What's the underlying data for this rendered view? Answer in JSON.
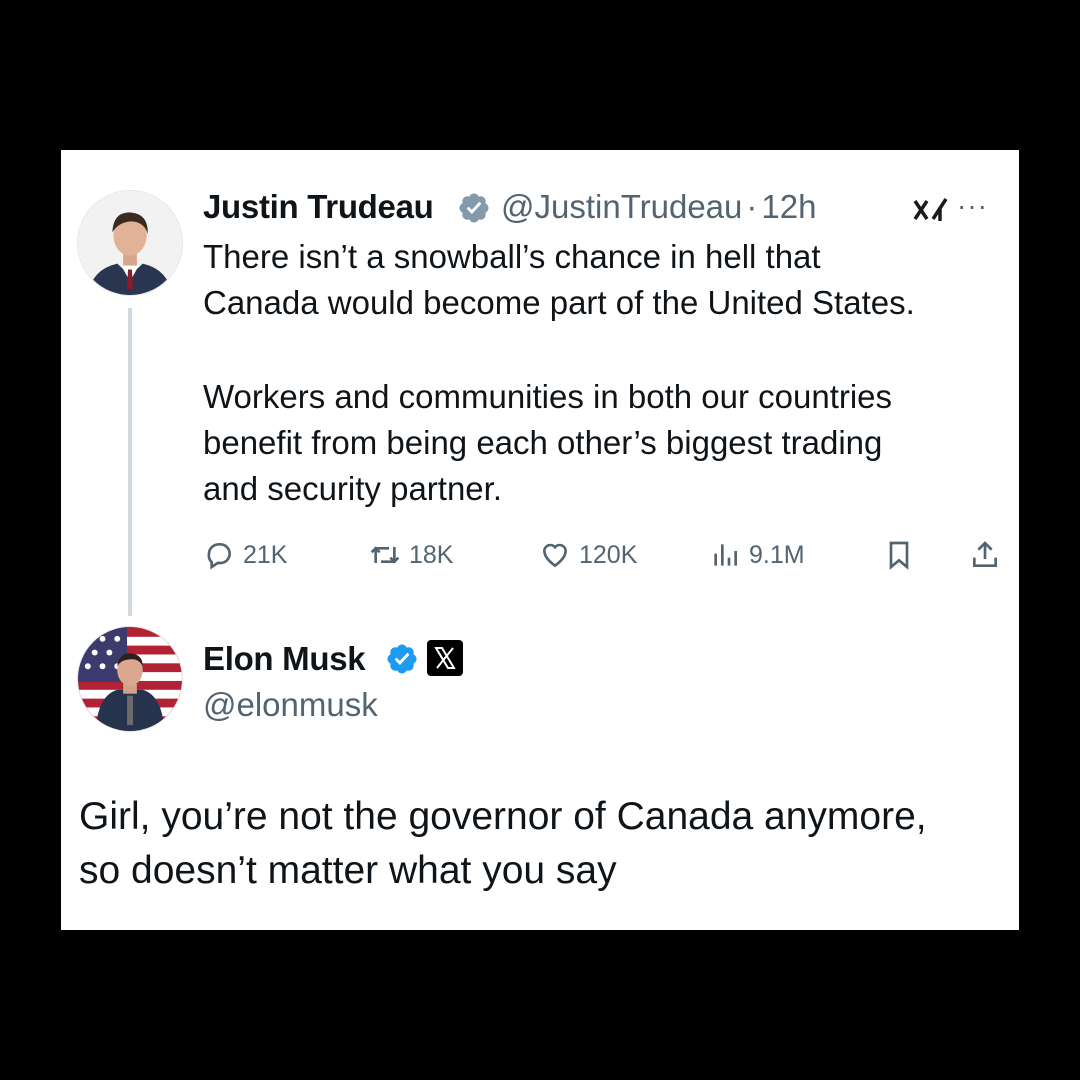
{
  "tweet1": {
    "author_name": "Justin Trudeau",
    "handle": "@JustinTrudeau",
    "separator": "·",
    "time": "12h",
    "avatar_icon": "person-avatar",
    "verified_icon": "verified-badge-icon",
    "verified_color": "#829aab",
    "text_lines": [
      "There isn’t a snowball’s chance in hell that",
      "Canada would become part of the United States.",
      "Workers and communities in both our countries",
      "benefit from being each other’s biggest trading",
      "and security partner."
    ],
    "stats": {
      "replies": "21K",
      "reposts": "18K",
      "likes": "120K",
      "views": "9.1M"
    }
  },
  "tweet2": {
    "author_name": "Elon Musk",
    "handle": "@elonmusk",
    "verified_color": "#1d9bf0",
    "affiliation_icon": "x-logo-icon",
    "text_lines": [
      "Girl, you’re not the governor of Canada anymore,",
      "so doesn’t matter what you say"
    ]
  },
  "colors": {
    "background": "#000000",
    "card": "#ffffff",
    "text": "#0f1419",
    "secondary": "#536471",
    "thread_line": "#cfd9de"
  }
}
